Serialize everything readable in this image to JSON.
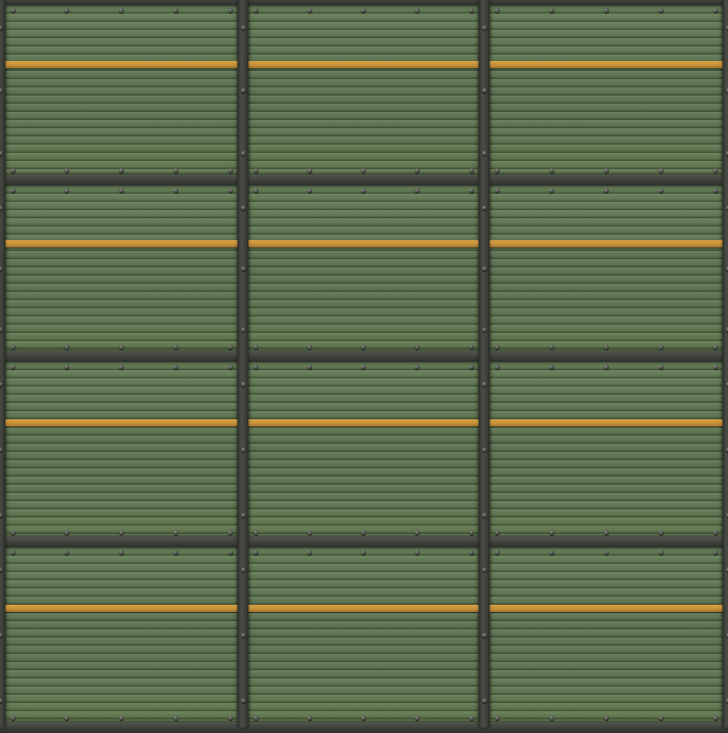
{
  "texture": {
    "grid": {
      "columns": 3,
      "rows": 4
    },
    "colors": {
      "panel": "#5f7551",
      "stripe": "#c8923a",
      "frame": "#3f413c",
      "rivet": "#5a5c57"
    }
  }
}
